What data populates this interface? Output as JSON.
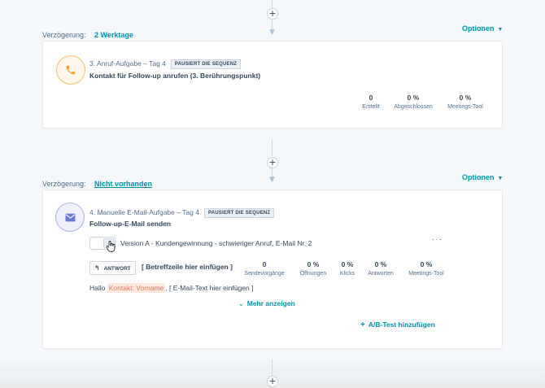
{
  "step1": {
    "delay_label": "Verzögerung:",
    "delay_value": "2 Werktage",
    "options_label": "Optionen",
    "task": {
      "icon": "phone-icon",
      "header": "3. Anruf-Aufgabe – Tag 4",
      "badge": "PAUSIERT DIE SEQUENZ",
      "title": "Kontakt für Follow-up anrufen (3. Berührungspunkt)",
      "stats": [
        {
          "value": "0",
          "label": "Erstellt"
        },
        {
          "value": "0 %",
          "label": "Abgeschlossen"
        },
        {
          "value": "0 %",
          "label": "Meetings-Tool"
        }
      ]
    }
  },
  "step2": {
    "delay_label": "Verzögerung:",
    "delay_value": "Nicht vorhanden",
    "options_label": "Optionen",
    "task": {
      "icon": "envelope-icon",
      "header": "4. Manuelle E-Mail-Aufgabe – Tag 4",
      "badge": "PAUSIERT DIE SEQUENZ",
      "title": "Follow-up-E-Mail senden",
      "version_label": "Version A - Kundengewinnung - schwieriger Anruf, E-Mail Nr. 2",
      "more_icon": "ellipsis-icon",
      "reply_tag": "ANTWORT",
      "subject": "[ Betreffzeile hier einfügen ]",
      "body_prefix": "Hallo",
      "body_token": "Kontakt: Vorname",
      "body_suffix": ", [ E-Mail-Text hier einfügen ]",
      "show_more": "Mehr anzeigen",
      "ab_test": "A/B-Test hinzufügen",
      "stats": [
        {
          "value": "0",
          "label": "Sendevorgänge"
        },
        {
          "value": "0 %",
          "label": "Öffnungen"
        },
        {
          "value": "0 %",
          "label": "Klicks"
        },
        {
          "value": "0 %",
          "label": "Antworten"
        },
        {
          "value": "0 %",
          "label": "Meetings-Tool"
        }
      ]
    }
  },
  "plus_symbol": "+",
  "colors": {
    "accent": "#0091ae",
    "call_icon": "#f5a623",
    "mail_icon": "#6a78d1",
    "token_bg": "#fde8e0",
    "token_text": "#e4795a"
  }
}
